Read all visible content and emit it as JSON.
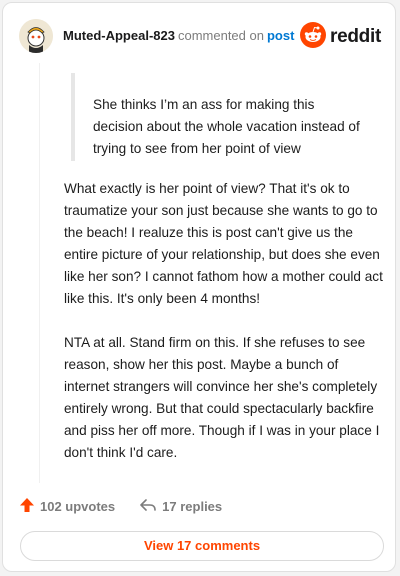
{
  "comment": {
    "username": "Muted-Appeal-823",
    "commented_text": "commented on",
    "post_link": "post",
    "brand": "reddit",
    "quote": "She thinks I’m an ass for making this decision about the whole vacation instead of trying to see from her point of view",
    "paragraphs": [
      "What exactly is her point of view? That it's ok to traumatize your son just because she wants to go to the beach! I realuze this is post can't give us the entire picture of your relationship, but does she even like her son? I cannot fathom how a mother could act like this. It's only been 4 months!",
      "NTA at all. Stand firm on this. If she refuses to see reason, show her this post. Maybe a bunch of internet strangers will convince her she's completely entirely wrong. But that could spectacularly backfire and piss her off more. Though if I was in your place I don't think I'd care."
    ]
  },
  "actions": {
    "upvotes": "102 upvotes",
    "replies": "17 replies"
  },
  "footer": {
    "view_comments": "View 17 comments"
  },
  "colors": {
    "upvote": "#ff4500",
    "link": "#0079d3",
    "button_text": "#ff4500"
  },
  "icons": [
    "avatar",
    "reddit-logo-icon",
    "upvote-arrow-icon",
    "reply-arrow-icon"
  ]
}
